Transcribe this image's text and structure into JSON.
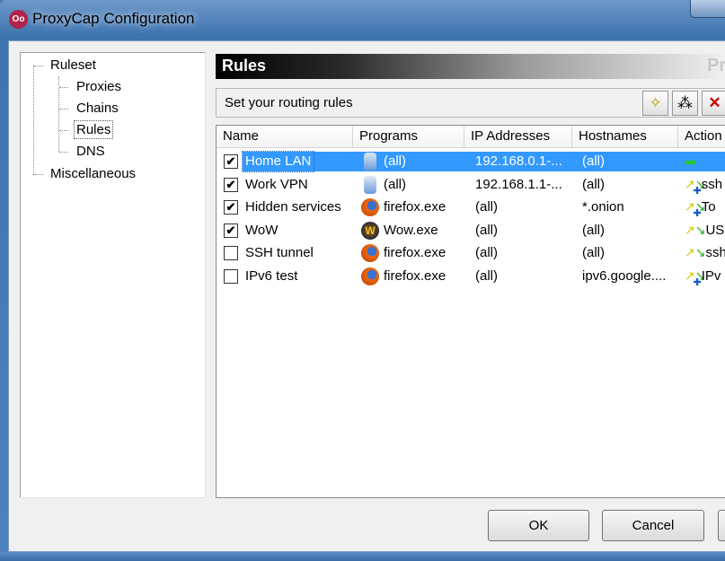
{
  "window": {
    "title": "ProxyCap Configuration"
  },
  "tree": {
    "items": [
      {
        "label": "Ruleset",
        "level": 0
      },
      {
        "label": "Proxies",
        "level": 1
      },
      {
        "label": "Chains",
        "level": 1
      },
      {
        "label": "Rules",
        "level": 1,
        "selected": true
      },
      {
        "label": "DNS",
        "level": 1
      },
      {
        "label": "Miscellaneous",
        "level": 0
      }
    ]
  },
  "panel": {
    "title": "Rules",
    "brand_fragment": "Pr",
    "subtitle": "Set your routing rules",
    "toolbar": [
      {
        "icon": "new-rule-icon"
      },
      {
        "icon": "wizard-icon"
      },
      {
        "icon": "delete-icon"
      }
    ]
  },
  "table": {
    "columns": [
      "Name",
      "Programs",
      "IP Addresses",
      "Hostnames",
      "Action"
    ],
    "rows": [
      {
        "checked": true,
        "name": "Home LAN",
        "program_icon": "computer-icon",
        "program": "(all)",
        "ip": "192.168.0.1-...",
        "host": "(all)",
        "action_icon": "direct-arrow-icon",
        "action": "",
        "selected": true
      },
      {
        "checked": true,
        "name": "Work VPN",
        "program_icon": "computer-icon",
        "program": "(all)",
        "ip": "192.168.1.1-...",
        "host": "(all)",
        "action_icon": "redirect-chain-icon",
        "action": "ssh"
      },
      {
        "checked": true,
        "name": "Hidden services",
        "program_icon": "firefox-icon",
        "program": "firefox.exe",
        "ip": "(all)",
        "host": "*.onion",
        "action_icon": "redirect-chain-icon",
        "action": "To"
      },
      {
        "checked": true,
        "name": "WoW",
        "program_icon": "wow-icon",
        "program": "Wow.exe",
        "ip": "(all)",
        "host": "(all)",
        "action_icon": "redirect-icon",
        "action": "US"
      },
      {
        "checked": false,
        "name": "SSH tunnel",
        "program_icon": "firefox-icon",
        "program": "firefox.exe",
        "ip": "(all)",
        "host": "(all)",
        "action_icon": "redirect-icon",
        "action": "ssh"
      },
      {
        "checked": false,
        "name": "IPv6 test",
        "program_icon": "firefox-icon",
        "program": "firefox.exe",
        "ip": "(all)",
        "host": "ipv6.google....",
        "action_icon": "redirect-chain-icon",
        "action": "IPv"
      }
    ]
  },
  "buttons": {
    "ok": "OK",
    "cancel": "Cancel"
  }
}
